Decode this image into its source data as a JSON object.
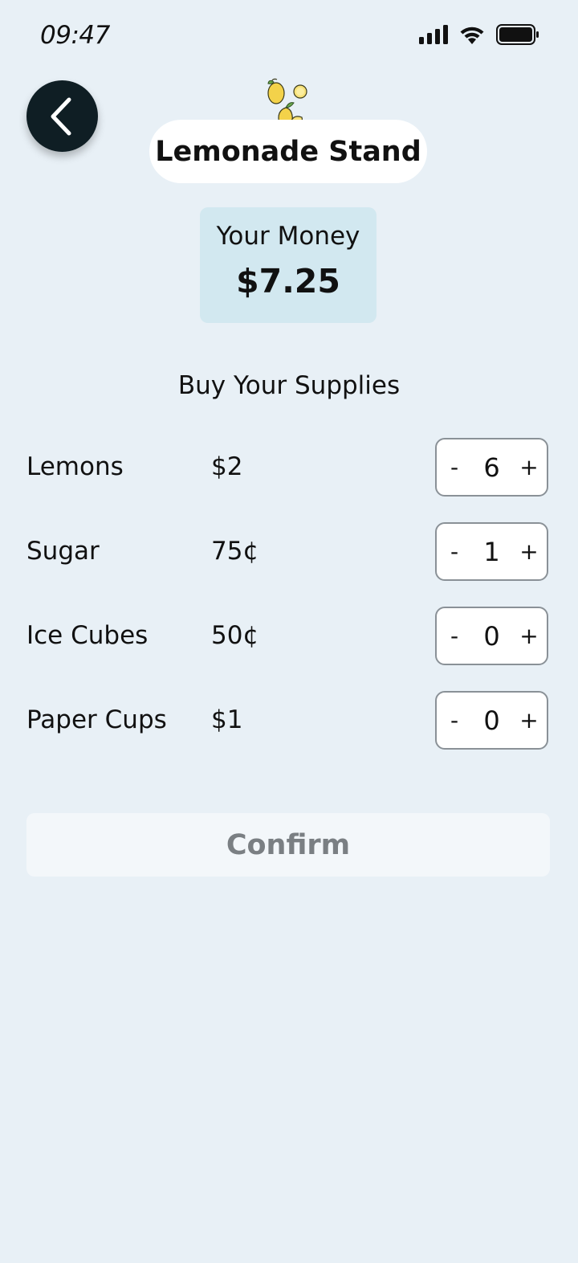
{
  "status_bar": {
    "time": "09:47"
  },
  "header": {
    "back_icon": "chevron-left-icon",
    "logo_icon": "lemons-icon",
    "title": "Lemonade Stand"
  },
  "money": {
    "label": "Your Money",
    "amount": "$7.25"
  },
  "supplies": {
    "heading": "Buy Your Supplies",
    "items": [
      {
        "name": "Lemons",
        "price": "$2",
        "quantity": "6"
      },
      {
        "name": "Sugar",
        "price": "75¢",
        "quantity": "1"
      },
      {
        "name": "Ice Cubes",
        "price": "50¢",
        "quantity": "0"
      },
      {
        "name": "Paper Cups",
        "price": "$1",
        "quantity": "0"
      }
    ],
    "minus_label": "-",
    "plus_label": "+"
  },
  "confirm": {
    "label": "Confirm"
  },
  "colors": {
    "background": "#e8f0f6",
    "back_button": "#0f1e24",
    "money_card": "#d2e8f0",
    "confirm_disabled_text": "#7a7f83"
  }
}
